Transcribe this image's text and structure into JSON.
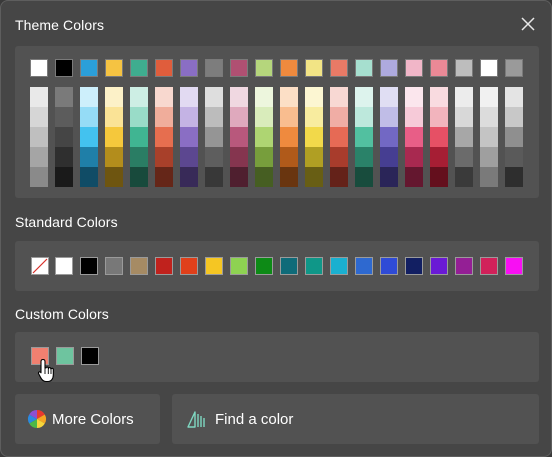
{
  "dialog": {
    "title": "Theme Colors",
    "close_icon": "close-icon"
  },
  "theme": {
    "top": [
      "#ffffff",
      "#000000",
      "#2b9fd9",
      "#f5c342",
      "#3fad8f",
      "#e05d3c",
      "#8a6ec4",
      "#7d7d7d",
      "#b05072",
      "#b5d67c",
      "#ef8a3e",
      "#f2e485",
      "#e87a66",
      "#a6dfcf",
      "#aeaade",
      "#f1b6c8",
      "#ea8996",
      "#bdbdbd",
      "#ffffff",
      "#9a9a9a"
    ],
    "shades": [
      [
        "#e9e9e9",
        "#d6d6d6",
        "#bfbfbf",
        "#a5a5a5",
        "#8a8a8a"
      ],
      [
        "#7a7a7a",
        "#5c5c5c",
        "#454545",
        "#2f2f2f",
        "#1a1a1a"
      ],
      [
        "#cdeffb",
        "#95dcf6",
        "#43c2ef",
        "#1f7fa8",
        "#104c66"
      ],
      [
        "#fcf1c8",
        "#fae396",
        "#f5c83c",
        "#b38d1c",
        "#6e5510"
      ],
      [
        "#cdeee4",
        "#99dcc8",
        "#40b592",
        "#2a7d64",
        "#184a3c"
      ],
      [
        "#f8d8cf",
        "#f0ad9b",
        "#e66e4f",
        "#a8402a",
        "#652618"
      ],
      [
        "#e2daf2",
        "#c4b3e4",
        "#8a6ec4",
        "#5c4790",
        "#382a58"
      ],
      [
        "#dedede",
        "#bcbcbc",
        "#959595",
        "#5e5e5e",
        "#383838"
      ],
      [
        "#f0d8e1",
        "#dfa9bd",
        "#b8587c",
        "#85354f",
        "#4f1f2f"
      ],
      [
        "#edf6dd",
        "#d9ecbb",
        "#aed572",
        "#779e3c",
        "#465e22"
      ],
      [
        "#fcdfc6",
        "#f9bd8f",
        "#ef8a3e",
        "#b05a1a",
        "#69350f"
      ],
      [
        "#fcf6d2",
        "#f8ec9f",
        "#f2d94a",
        "#b09f23",
        "#685e14"
      ],
      [
        "#f8d8d3",
        "#f0ada5",
        "#e66a55",
        "#a83c2c",
        "#642219"
      ],
      [
        "#ddf3ed",
        "#bde8dc",
        "#52c0a0",
        "#2a8269",
        "#184c3d"
      ],
      [
        "#e0def3",
        "#c0bde7",
        "#7268c4",
        "#463e92",
        "#2a2558"
      ],
      [
        "#fbe6ed",
        "#f6cad8",
        "#e85e87",
        "#a82950",
        "#64172f"
      ],
      [
        "#f9dbe0",
        "#f2b4bd",
        "#e65065",
        "#a61e34",
        "#640f1d"
      ],
      [
        "#ececec",
        "#d8d8d8",
        "#a7a7a7",
        "#6b6b6b",
        "#3a3a3a"
      ],
      [
        "#f1f1f1",
        "#dcdcdc",
        "#c4c4c4",
        "#9f9f9f",
        "#7a7a7a"
      ],
      [
        "#e4e4e4",
        "#c8c8c8",
        "#8f8f8f",
        "#5a5a5a",
        "#2e2e2e"
      ]
    ]
  },
  "standard": {
    "title": "Standard Colors",
    "no_color_icon": "no-color-icon",
    "colors": [
      "#ffffff",
      "#000000",
      "#787878",
      "#a68b64",
      "#c0221d",
      "#e0401b",
      "#f5c623",
      "#8ed252",
      "#0d8a16",
      "#0f6b79",
      "#0f9788",
      "#1ab0d0",
      "#2e69d0",
      "#2f4bd6",
      "#121f62",
      "#6a1ad5",
      "#941f95",
      "#d1215a",
      "#f80ff3"
    ]
  },
  "custom": {
    "title": "Custom Colors",
    "colors": [
      "#f08070",
      "#6ec49f",
      "#000000"
    ]
  },
  "buttons": {
    "more_colors": "More Colors",
    "more_colors_icon": "color-wheel-icon",
    "find_color": "Find a color",
    "find_color_icon": "eyedropper-icon"
  },
  "pointer": "hand-cursor-icon"
}
